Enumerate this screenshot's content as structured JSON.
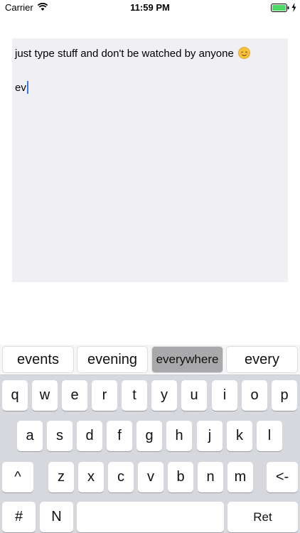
{
  "status_bar": {
    "carrier": "Carrier",
    "time": "11:59 PM",
    "icons": [
      "wifi-icon",
      "battery-icon",
      "charging-bolt-icon"
    ]
  },
  "editor": {
    "line1": "just type stuff and don't be watched by anyone",
    "line1_emoji": "smiling-face-emoji-icon",
    "line2": "ev",
    "cursor_color": "#3478f6",
    "background": "#efeff4"
  },
  "keyboard": {
    "suggestions": [
      "events",
      "evening",
      "everywhere",
      "every"
    ],
    "selected_suggestion": "everywhere",
    "row1": [
      "q",
      "w",
      "e",
      "r",
      "t",
      "y",
      "u",
      "i",
      "o",
      "p"
    ],
    "row2": [
      "a",
      "s",
      "d",
      "f",
      "g",
      "h",
      "j",
      "k",
      "l"
    ],
    "row3": [
      "^",
      "z",
      "x",
      "c",
      "v",
      "b",
      "n",
      "m",
      "<-"
    ],
    "row4": {
      "hash": "#",
      "n": "N",
      "space": "",
      "return": "Ret"
    }
  }
}
